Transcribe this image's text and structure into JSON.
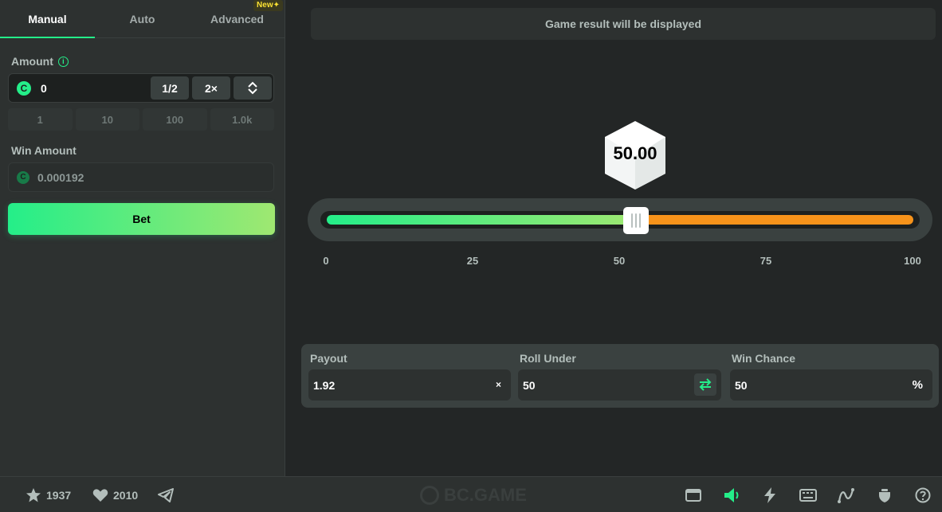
{
  "tabs": [
    {
      "label": "Manual",
      "active": true
    },
    {
      "label": "Auto",
      "active": false
    },
    {
      "label": "Advanced",
      "active": false,
      "badge": "New"
    }
  ],
  "amount": {
    "label": "Amount",
    "value": "0",
    "half_label": "1/2",
    "double_label": "2×",
    "quick": [
      "1",
      "10",
      "100",
      "1.0k"
    ]
  },
  "win_amount": {
    "label": "Win Amount",
    "value": "0.000192"
  },
  "bet_label": "Bet",
  "result_text": "Game result will be displayed",
  "dice_value": "50.00",
  "slider": {
    "value": 50,
    "ticks": [
      "0",
      "25",
      "50",
      "75",
      "100"
    ]
  },
  "stats": {
    "payout": {
      "label": "Payout",
      "value": "1.92",
      "suffix": "×"
    },
    "roll_under": {
      "label": "Roll Under",
      "value": "50"
    },
    "win_chance": {
      "label": "Win Chance",
      "value": "50",
      "suffix": "%"
    }
  },
  "footer": {
    "stars": "1937",
    "likes": "2010",
    "brand": "BC.GAME",
    "icons": [
      "star-icon",
      "heart-icon",
      "telegram-icon",
      "card-icon",
      "sound-icon",
      "lightning-icon",
      "keyboard-icon",
      "chart-icon",
      "fairness-icon",
      "help-icon"
    ]
  },
  "colors": {
    "accent": "#24ee89",
    "accent_end": "#9fe871",
    "over": "#f7931a",
    "bg": "#232626",
    "panel": "#2d3130"
  }
}
